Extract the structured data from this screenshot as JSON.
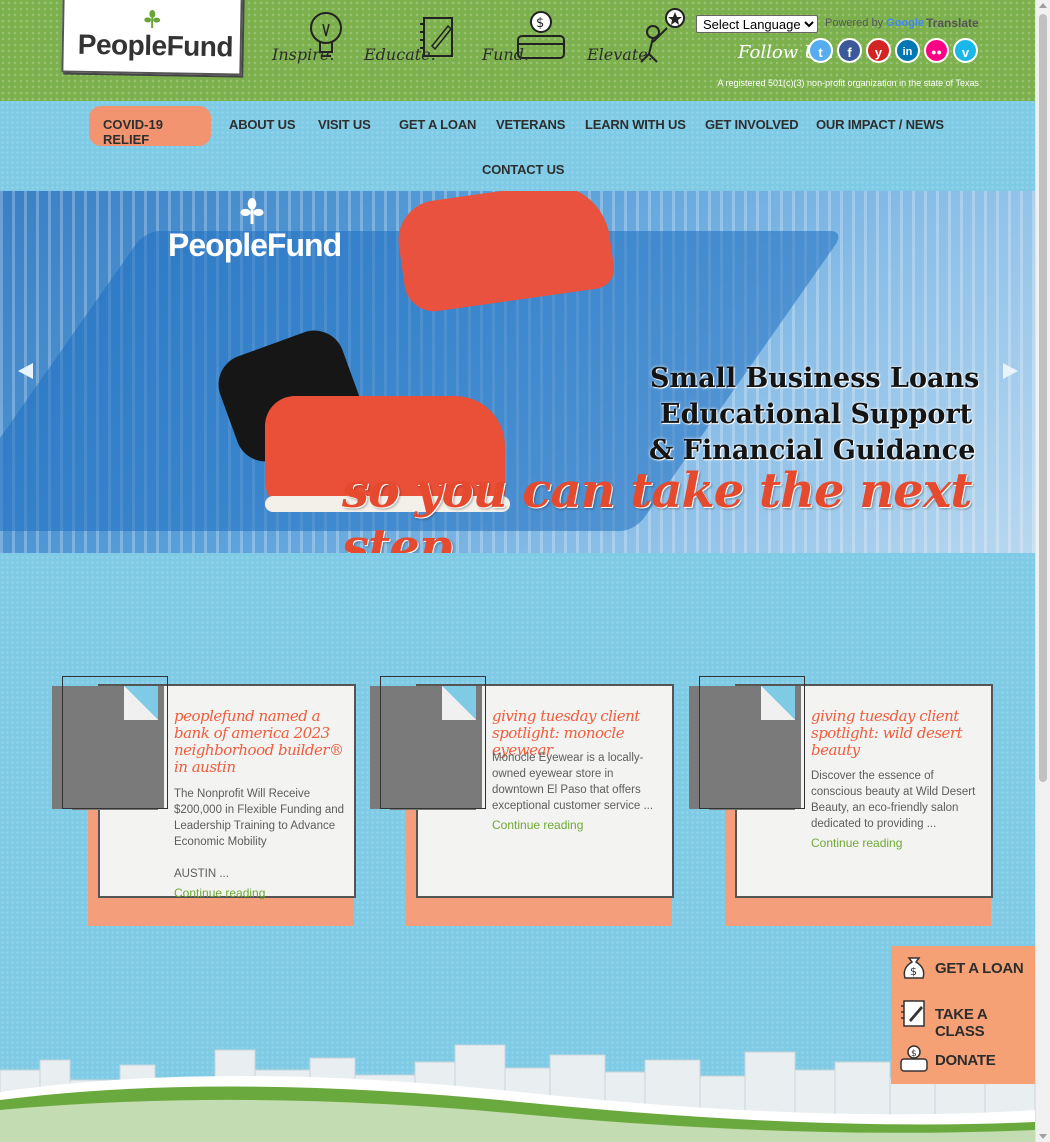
{
  "header": {
    "logo_text": "PeopleFund",
    "pillars": [
      {
        "label": "Inspire.",
        "icon": "lightbulb-icon"
      },
      {
        "label": "Educate.",
        "icon": "notebook-icon"
      },
      {
        "label": "Fund.",
        "icon": "money-box-icon"
      },
      {
        "label": "Elevate.",
        "icon": "person-star-icon"
      }
    ],
    "language_select": "Select Language",
    "powered_by": "Powered by",
    "google": "Google",
    "translate": "Translate",
    "follow_us": "Follow Us:",
    "social": [
      {
        "name": "twitter-icon",
        "glyph": "t",
        "color": "#55acee"
      },
      {
        "name": "facebook-icon",
        "glyph": "f",
        "color": "#3b5998"
      },
      {
        "name": "yelp-icon",
        "glyph": "y",
        "color": "#d32323"
      },
      {
        "name": "linkedin-icon",
        "glyph": "in",
        "color": "#0077b5"
      },
      {
        "name": "flickr-icon",
        "glyph": "●●",
        "color": "#ff0084"
      },
      {
        "name": "vimeo-icon",
        "glyph": "v",
        "color": "#1ab7ea"
      }
    ],
    "registered": "A registered 501(c)(3) non-profit organization in the state of Texas"
  },
  "nav": {
    "items": [
      "COVID-19 RELIEF",
      "ABOUT US",
      "VISIT US",
      "GET A LOAN",
      "VETERANS",
      "LEARN WITH US",
      "GET INVOLVED",
      "OUR IMPACT / NEWS",
      "CONTACT US"
    ]
  },
  "hero": {
    "logo": "PeopleFund",
    "lines": [
      "Small Business Loans",
      "Educational Support",
      "& Financial Guidance"
    ],
    "tagline": "so you can take the next step."
  },
  "posts": [
    {
      "title": "peoplefund named a bank of america 2023 neighborhood builder® in austin",
      "excerpt": "The Nonprofit Will Receive $200,000 in Flexible Funding and Leadership Training to Advance Economic Mobility",
      "excerpt2": "AUSTIN ...",
      "more": "Continue reading"
    },
    {
      "title": "giving tuesday client spotlight: monocle eyewear",
      "excerpt": "Monocle Eyewear is a locally-owned eyewear store in downtown El Paso that offers exceptional customer service ...",
      "excerpt2": "",
      "more": "Continue reading"
    },
    {
      "title": "giving tuesday client spotlight: wild desert beauty",
      "excerpt": "Discover the essence of conscious beauty at Wild Desert Beauty, an eco-friendly salon dedicated to providing ...",
      "excerpt2": "",
      "more": "Continue reading"
    }
  ],
  "cta": [
    {
      "label": "GET A LOAN",
      "icon": "money-bag-icon"
    },
    {
      "label": "TAKE A CLASS",
      "icon": "notebook-pencil-icon"
    },
    {
      "label": "DONATE",
      "icon": "donation-box-icon"
    }
  ],
  "colors": {
    "header_green": "#7bb04c",
    "sky_blue": "#7fcbe6",
    "accent_orange": "#f39470",
    "title_orange": "#ef5d3d",
    "link_green": "#6fa934"
  }
}
